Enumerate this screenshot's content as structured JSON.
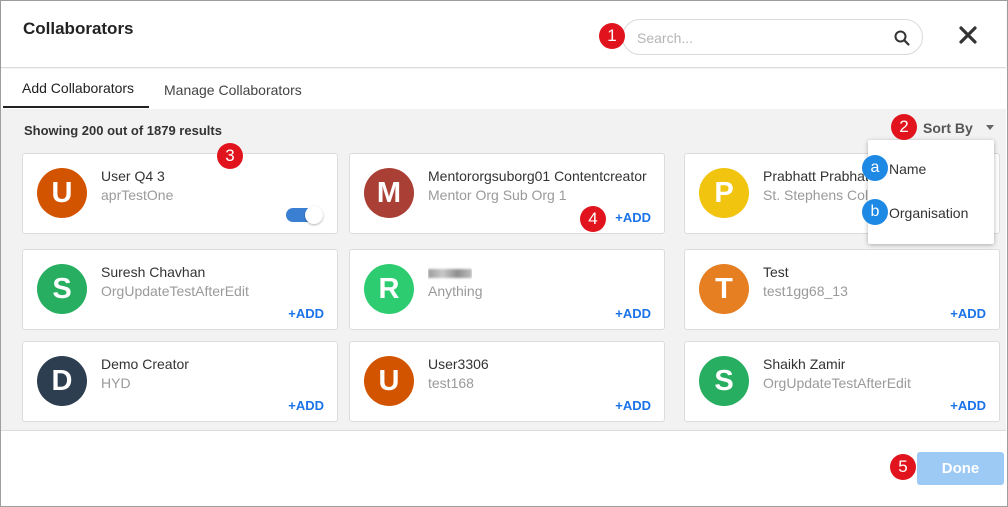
{
  "header": {
    "title": "Collaborators",
    "search_placeholder": "Search...",
    "search_value": ""
  },
  "tabs": [
    {
      "label": "Add Collaborators",
      "active": true
    },
    {
      "label": "Manage Collaborators",
      "active": false
    }
  ],
  "results_text": "Showing 200 out of 1879 results",
  "sort": {
    "label": "Sort By",
    "options": [
      "Name",
      "Organisation"
    ]
  },
  "cards": [
    {
      "initial": "U",
      "name": "User Q4 3",
      "org": "aprTestOne",
      "color": "#d35400",
      "action": "toggle",
      "toggle_on": true
    },
    {
      "initial": "M",
      "name": "Mentororgsuborg01 Contentcreator",
      "org": "Mentor Org Sub Org 1",
      "color": "#a93f35",
      "action": "+ADD"
    },
    {
      "initial": "P",
      "name": "Prabhatt Prabhatt",
      "org": "St. Stephens College",
      "color": "#f1c40f",
      "action": "+ADD"
    },
    {
      "initial": "S",
      "name": "Suresh Chavhan",
      "org": "OrgUpdateTestAfterEdit",
      "color": "#27ae60",
      "action": "+ADD"
    },
    {
      "initial": "R",
      "name": "",
      "org": "Anything",
      "color": "#2ecc71",
      "action": "+ADD",
      "name_redacted": true
    },
    {
      "initial": "T",
      "name": "Test",
      "org": "test1gg68_13",
      "color": "#e67e22",
      "action": "+ADD"
    },
    {
      "initial": "D",
      "name": "Demo Creator",
      "org": "HYD",
      "color": "#2c3e50",
      "action": "+ADD"
    },
    {
      "initial": "U",
      "name": "User3306",
      "org": "test168",
      "color": "#d35400",
      "action": "+ADD"
    },
    {
      "initial": "S",
      "name": "Shaikh Zamir",
      "org": "OrgUpdateTestAfterEdit",
      "color": "#27ae60",
      "action": "+ADD"
    }
  ],
  "footer": {
    "done_label": "Done"
  },
  "annotations": {
    "numbered": [
      "1",
      "2",
      "3",
      "4",
      "5"
    ],
    "lettered": [
      "a",
      "b"
    ]
  },
  "colors": {
    "accent": "#1a73e8",
    "done_button": "#9dc9f5",
    "marker_red": "#e1141e",
    "marker_blue": "#1e88e5",
    "toggle_on": "#3b7fd2"
  }
}
